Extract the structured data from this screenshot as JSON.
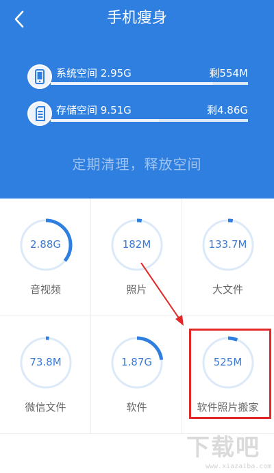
{
  "header": {
    "title": "手机瘦身",
    "back_icon": "chevron-left-icon"
  },
  "storage": [
    {
      "icon": "phone-icon",
      "label": "系统空间 2.95G",
      "remaining": "剩554M",
      "used_fraction": 0.82
    },
    {
      "icon": "sd-card-icon",
      "label": "存储空间 9.51G",
      "remaining": "剩4.86G",
      "used_fraction": 0.55
    }
  ],
  "slogan": "定期清理，释放空间",
  "categories": [
    {
      "size": "2.88G",
      "name": "音视频",
      "fraction": 0.36
    },
    {
      "size": "182M",
      "name": "照片",
      "fraction": 0.03
    },
    {
      "size": "133.7M",
      "name": "大文件",
      "fraction": 0.03
    },
    {
      "size": "73.8M",
      "name": "微信文件",
      "fraction": 0.02
    },
    {
      "size": "1.87G",
      "name": "软件",
      "fraction": 0.23
    },
    {
      "size": "525M",
      "name": "软件照片搬家",
      "fraction": 0.06
    }
  ],
  "watermark": {
    "main": "下载吧",
    "sub": "www.xiazaiba.com"
  },
  "colors": {
    "header_bg": "#2f7fe0",
    "ring_track": "#dce9f8",
    "ring_fill": "#2f7fe0",
    "annotation": "#e32626"
  }
}
